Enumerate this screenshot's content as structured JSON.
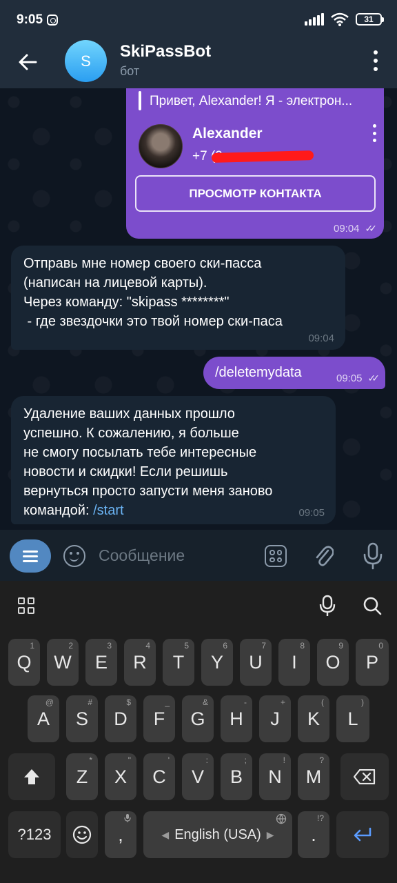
{
  "status_bar": {
    "time": "9:05",
    "battery": "31"
  },
  "header": {
    "avatar_letter": "S",
    "title": "SkiPassBot",
    "subtitle": "бот"
  },
  "messages": {
    "contact": {
      "reply_preview": "Привет, Alexander!  Я - электрон...",
      "name": "Alexander",
      "phone_prefix": "+7 (9",
      "button": "ПРОСМОТР КОНТАКТА",
      "time": "09:04"
    },
    "bot1": {
      "text": "Отправь мне номер своего ски-пасса\n(написан на лицевой карты).\nЧерез команду: \"skipass ********\"\n - где звездочки это твой номер ски-паса",
      "time": "09:04"
    },
    "user1": {
      "text": "/deletemydata",
      "time": "09:05"
    },
    "bot2": {
      "text": "Удаление ваших данных прошло\nуспешно. К сожалению, я больше\nне смогу посылать тебе интересные\nновости и скидки! Если решишь\nвернуться просто запусти меня заново\nкомандой: ",
      "link": "/start",
      "time": "09:05"
    }
  },
  "input": {
    "placeholder": "Сообщение"
  },
  "keyboard": {
    "row1": [
      {
        "k": "Q",
        "s": "1"
      },
      {
        "k": "W",
        "s": "2"
      },
      {
        "k": "E",
        "s": "3"
      },
      {
        "k": "R",
        "s": "4"
      },
      {
        "k": "T",
        "s": "5"
      },
      {
        "k": "Y",
        "s": "6"
      },
      {
        "k": "U",
        "s": "7"
      },
      {
        "k": "I",
        "s": "8"
      },
      {
        "k": "O",
        "s": "9"
      },
      {
        "k": "P",
        "s": "0"
      }
    ],
    "row2": [
      {
        "k": "A",
        "s": "@"
      },
      {
        "k": "S",
        "s": "#"
      },
      {
        "k": "D",
        "s": "$"
      },
      {
        "k": "F",
        "s": "_"
      },
      {
        "k": "G",
        "s": "&"
      },
      {
        "k": "H",
        "s": "-"
      },
      {
        "k": "J",
        "s": "+"
      },
      {
        "k": "K",
        "s": "("
      },
      {
        "k": "L",
        "s": ")"
      }
    ],
    "row3": [
      {
        "k": "Z",
        "s": "*"
      },
      {
        "k": "X",
        "s": "\""
      },
      {
        "k": "C",
        "s": "'"
      },
      {
        "k": "V",
        "s": ":"
      },
      {
        "k": "B",
        "s": ";"
      },
      {
        "k": "N",
        "s": "!"
      },
      {
        "k": "M",
        "s": "?"
      }
    ],
    "sym_label": "?123",
    "comma": ",",
    "space_label": "English (USA)",
    "period": ".",
    "period_sup": "!?"
  }
}
